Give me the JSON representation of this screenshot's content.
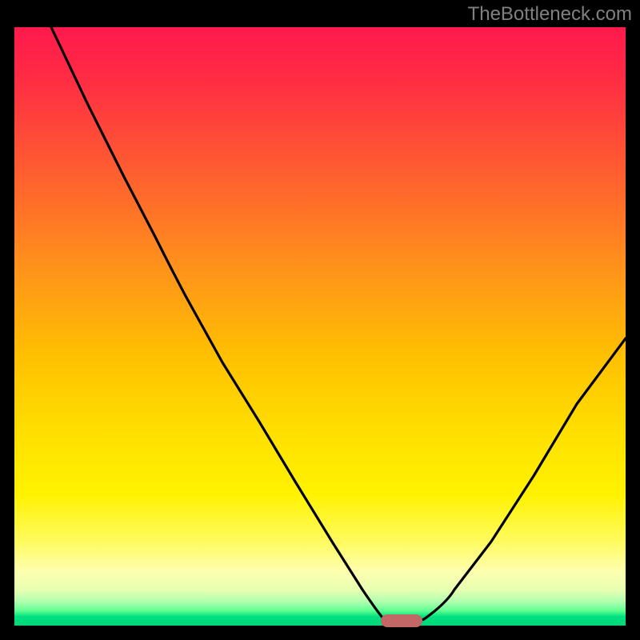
{
  "watermark": "TheBottleneck.com",
  "chart_data": {
    "type": "line",
    "title": "",
    "xlabel": "",
    "ylabel": "",
    "x_range_pct": [
      0,
      100
    ],
    "y_range_pct": [
      0,
      100
    ],
    "series": [
      {
        "name": "bottleneck-curve",
        "points_pct": [
          [
            6,
            100
          ],
          [
            12,
            87
          ],
          [
            18,
            75
          ],
          [
            23,
            65
          ],
          [
            28,
            55
          ],
          [
            34,
            44
          ],
          [
            40,
            34
          ],
          [
            46,
            24
          ],
          [
            52,
            14
          ],
          [
            57,
            6
          ],
          [
            61,
            1
          ],
          [
            64,
            0
          ],
          [
            67,
            1
          ],
          [
            72,
            6
          ],
          [
            78,
            14
          ],
          [
            85,
            25
          ],
          [
            92,
            37
          ],
          [
            100,
            48
          ]
        ]
      }
    ],
    "minimum_marker": {
      "x_pct": 63,
      "y_pct": 0,
      "width_pct": 6
    },
    "gradient_stops": [
      {
        "pos": 0,
        "color": "#ff1a4d"
      },
      {
        "pos": 50,
        "color": "#ffd000"
      },
      {
        "pos": 90,
        "color": "#fffc90"
      },
      {
        "pos": 100,
        "color": "#00d878"
      }
    ]
  }
}
